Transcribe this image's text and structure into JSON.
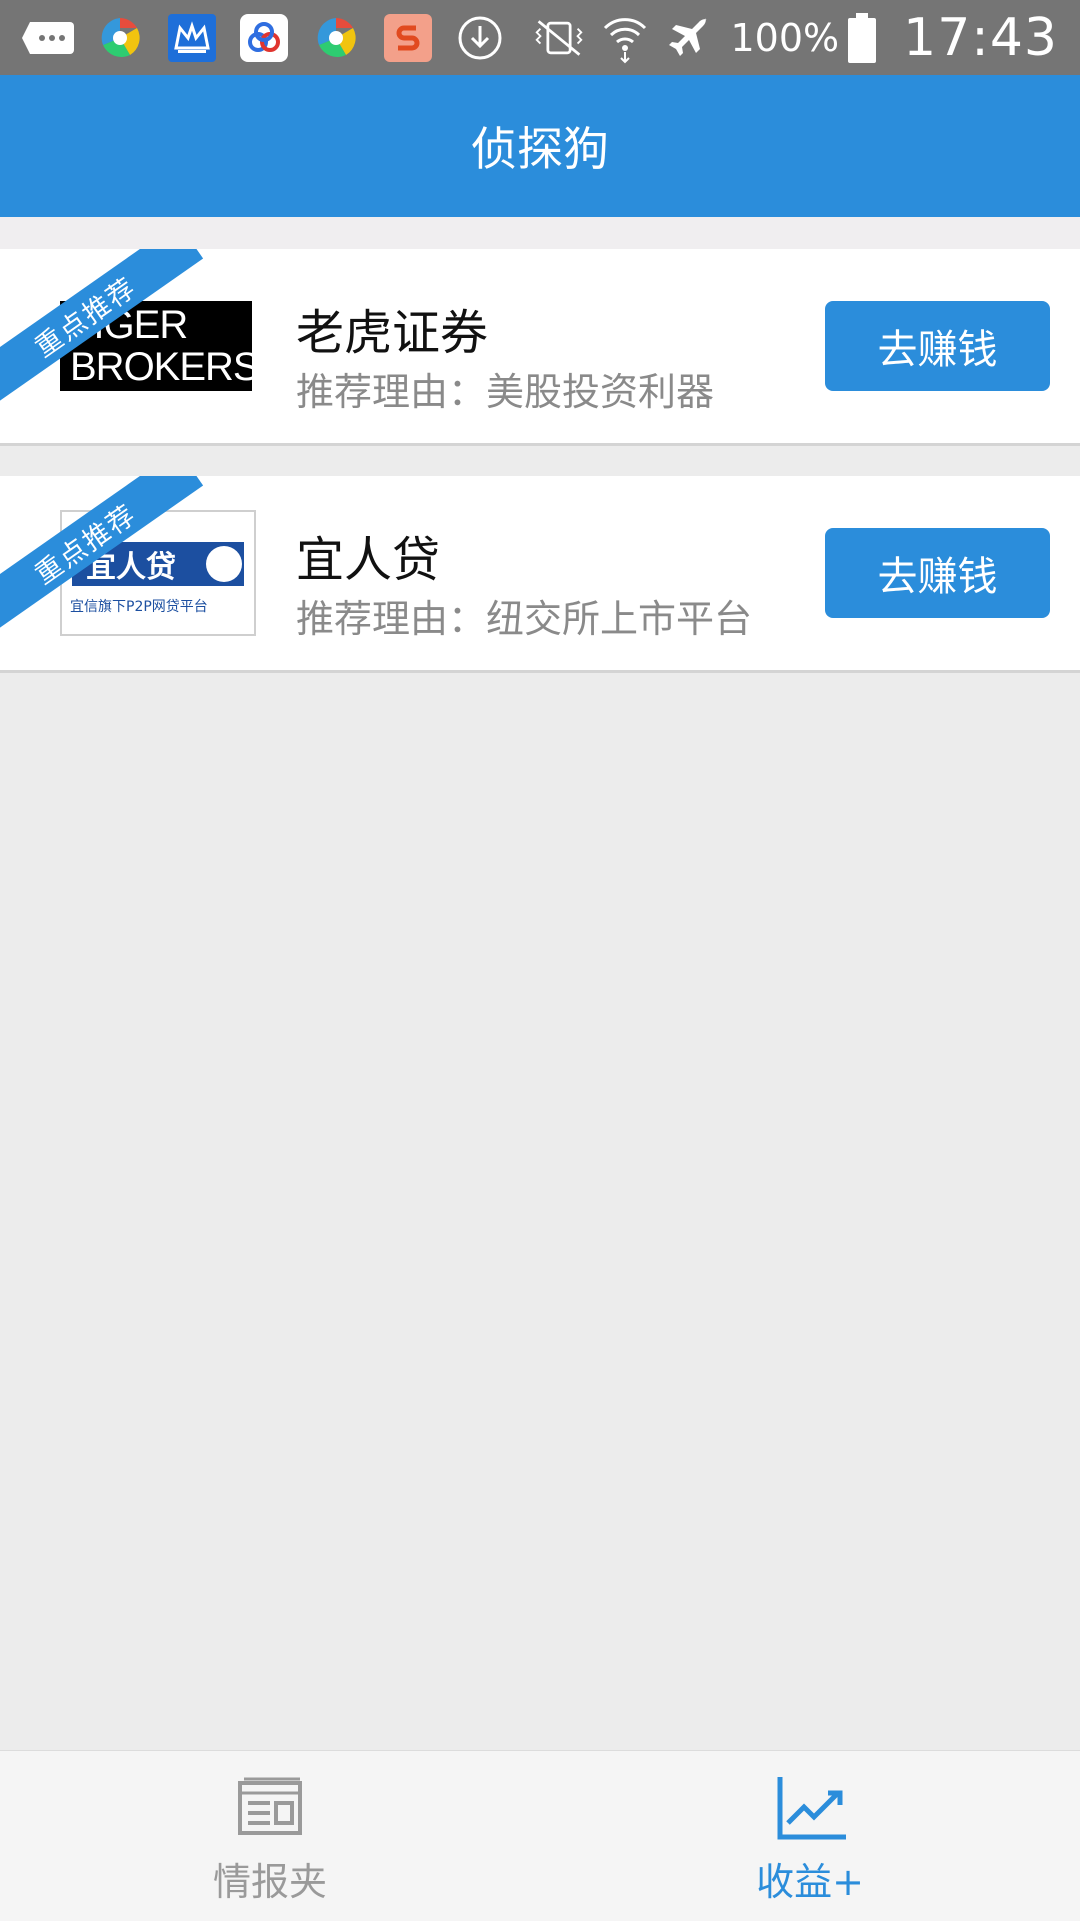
{
  "status_bar": {
    "battery_percent": "100%",
    "time": "17:43",
    "icons": [
      "chat-icon",
      "browser-icon",
      "crown-icon",
      "cloud-icon",
      "browser-icon",
      "sogou-icon",
      "download-icon",
      "vibrate-icon",
      "wifi-icon",
      "airplane-mode-icon",
      "battery-icon"
    ]
  },
  "header": {
    "title": "侦探狗"
  },
  "products": [
    {
      "name": "老虎证券",
      "reason": "推荐理由：美股投资利器",
      "ribbon": "重点推荐",
      "button": "去赚钱",
      "logo_lines": [
        "TIGER",
        "BROKERS"
      ]
    },
    {
      "name": "宜人贷",
      "reason": "推荐理由：纽交所上市平台",
      "ribbon": "重点推荐",
      "button": "去赚钱",
      "logo_text": "宜人贷",
      "logo_sub": "宜信旗下P2P网贷平台"
    }
  ],
  "bottom_nav": [
    {
      "label": "情报夹",
      "icon": "newspaper-icon",
      "active": false
    },
    {
      "label": "收益+",
      "icon": "line-chart-icon",
      "active": true
    }
  ],
  "colors": {
    "brand": "#2b8ddb",
    "status_bar": "#757575",
    "inactive": "#9a9a9a"
  }
}
